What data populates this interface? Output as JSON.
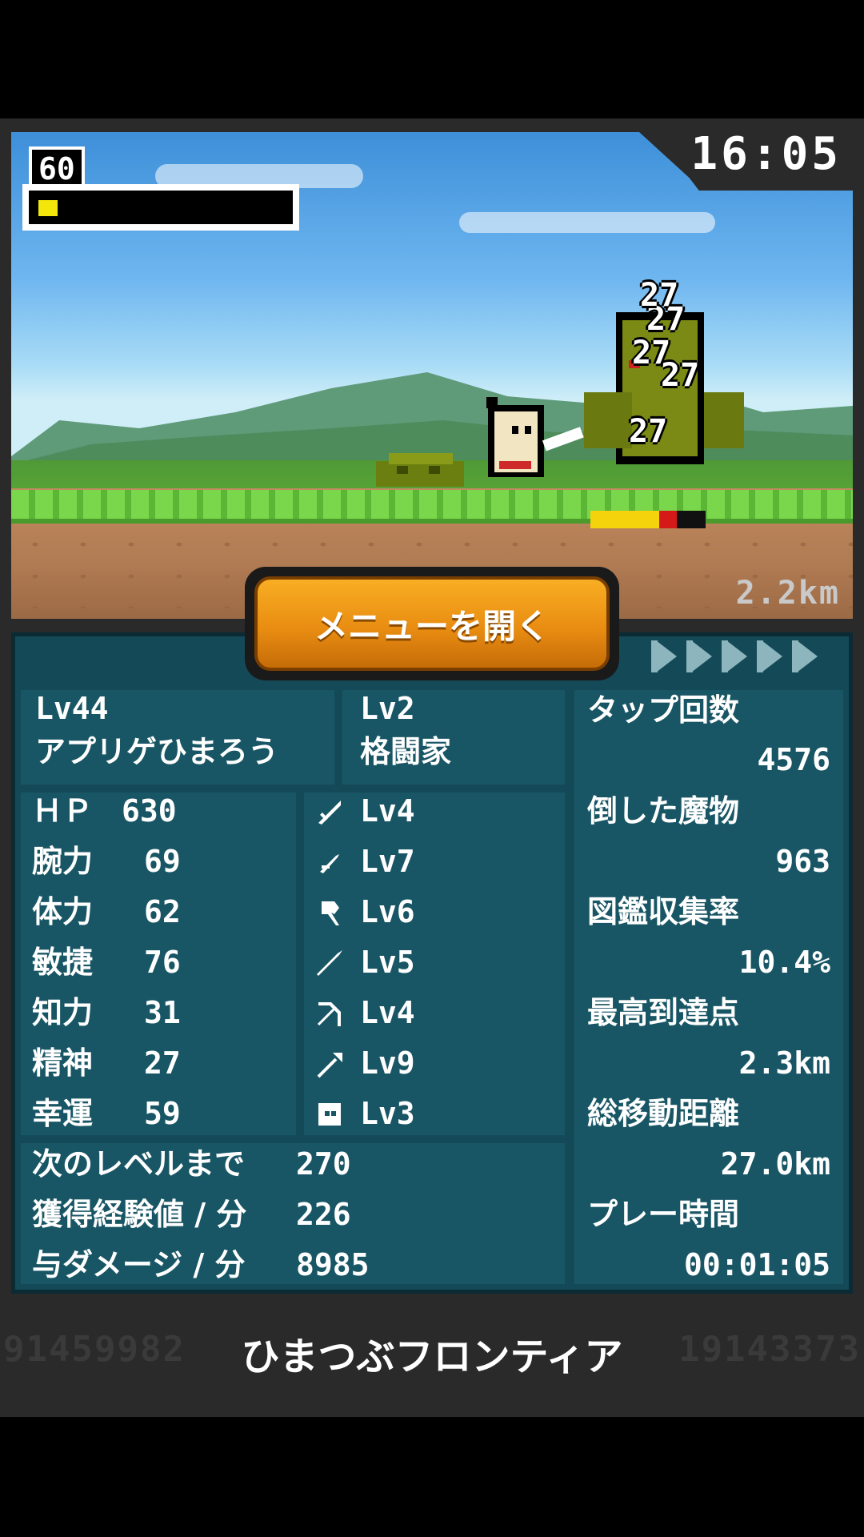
{
  "hud": {
    "player_level_short": "60",
    "clock": "16:05",
    "distance": "2.2km",
    "damage_popups": [
      "27",
      "27",
      "27",
      "27",
      "27"
    ]
  },
  "menu_button": {
    "label": "メニューを開く"
  },
  "character": {
    "level": "Lv44",
    "name": "アプリゲひまろう",
    "job_level": "Lv2",
    "job": "格闘家"
  },
  "stats": [
    {
      "label": "ＨＰ",
      "value": "630"
    },
    {
      "label": "腕力",
      "value": "69"
    },
    {
      "label": "体力",
      "value": "62"
    },
    {
      "label": "敏捷",
      "value": "76"
    },
    {
      "label": "知力",
      "value": "31"
    },
    {
      "label": "精神",
      "value": "27"
    },
    {
      "label": "幸運",
      "value": "59"
    }
  ],
  "skills": [
    {
      "icon": "sword-icon",
      "level": "Lv4"
    },
    {
      "icon": "dagger-icon",
      "level": "Lv7"
    },
    {
      "icon": "axe-icon",
      "level": "Lv6"
    },
    {
      "icon": "spear-icon",
      "level": "Lv5"
    },
    {
      "icon": "bow-icon",
      "level": "Lv4"
    },
    {
      "icon": "staff-icon",
      "level": "Lv9"
    },
    {
      "icon": "fist-icon",
      "level": "Lv3"
    }
  ],
  "progress": [
    {
      "label": "次のレベルまで",
      "value": "270"
    },
    {
      "label": "獲得経験値 / 分",
      "value": "226"
    },
    {
      "label": "与ダメージ / 分",
      "value": "8985"
    }
  ],
  "records": [
    {
      "label": "タップ回数",
      "value": "4576"
    },
    {
      "label": "倒した魔物",
      "value": "963"
    },
    {
      "label": "図鑑収集率",
      "value": "10.4%"
    },
    {
      "label": "最高到達点",
      "value": "2.3km"
    },
    {
      "label": "総移動距離",
      "value": "27.0km"
    },
    {
      "label": "プレー時間",
      "value": "00:01:05"
    }
  ],
  "footer": {
    "title": "ひまつぶフロンティア",
    "left_counter": "91459982",
    "right_counter": "19143373"
  },
  "colors": {
    "panel": "#144a58",
    "cell": "#195665",
    "button": "#e98d12",
    "gauge_fill": "#f3e60b"
  }
}
